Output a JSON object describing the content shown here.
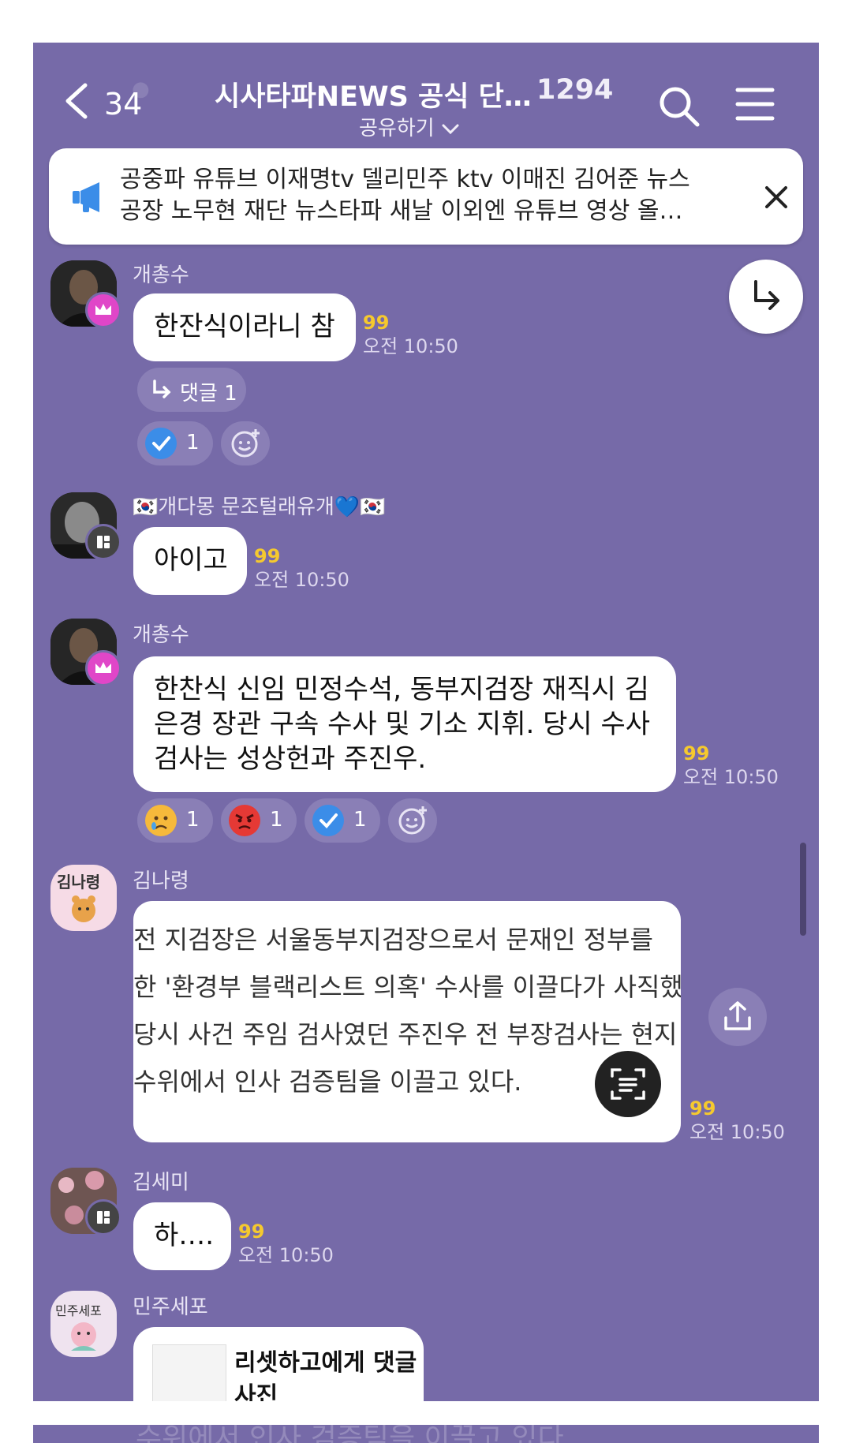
{
  "header": {
    "back_count": "34",
    "title": "시사타파NEWS 공식 단…",
    "member_count": "1294",
    "share_label": "공유하기",
    "chevron": "chevron-down-icon"
  },
  "notice": {
    "line1": "공중파 유튜브 이재명tv 델리민주 ktv 이매진 김어준 뉴스",
    "line2": "공장 노무현 재단 뉴스타파 새날 이외엔 유튜브 영상 올…",
    "icon": "megaphone-icon"
  },
  "messages": [
    {
      "sender": "개총수",
      "text": "한잔식이라니 참",
      "unread": "99",
      "time": "오전 10:50",
      "reply_label": "댓글 1",
      "reactions": [
        {
          "icon": "check-icon",
          "count": "1"
        }
      ]
    },
    {
      "sender": "🇰🇷개다몽 문조털래유개💙🇰🇷",
      "text": "아이고",
      "unread": "99",
      "time": "오전 10:50"
    },
    {
      "sender": "개총수",
      "lines": [
        "한찬식 신임 민정수석, 동부지검장 재직시 김",
        "은경 장관 구속 수사 및 기소 지휘. 당시 수사",
        "검사는 성상헌과 주진우."
      ],
      "unread": "99",
      "time": "오전 10:50",
      "reactions": [
        {
          "icon": "sad-face-icon",
          "count": "1"
        },
        {
          "icon": "angry-face-icon",
          "count": "1"
        },
        {
          "icon": "check-icon",
          "count": "1"
        }
      ]
    },
    {
      "sender": "김나령",
      "avatar_label": "김나령",
      "image_lines": [
        "전 지검장은 서울동부지검장으로서 문재인 정부를 ",
        "한 '환경부 블랙리스트 의혹' 수사를 이끌다가 사직했",
        " 당시 사건 주임 검사였던 주진우 전 부장검사는 현지",
        "수위에서 인사 검증팀을 이끌고 있다."
      ],
      "unread": "99",
      "time": "오전 10:50"
    },
    {
      "sender": "김세미",
      "text": "하….",
      "unread": "99",
      "time": "오전 10:50"
    },
    {
      "sender": "민주세포",
      "avatar_label": "민주세포",
      "link_title_1": "리셋하고에게 댓글",
      "link_title_2": "사진"
    }
  ],
  "bottom_ghost": "수위에서 인사 검증팀을 이끌고 있다.",
  "colors": {
    "background": "#766aa8",
    "unread": "#f5c92e",
    "chip": "#8a7fb6"
  }
}
